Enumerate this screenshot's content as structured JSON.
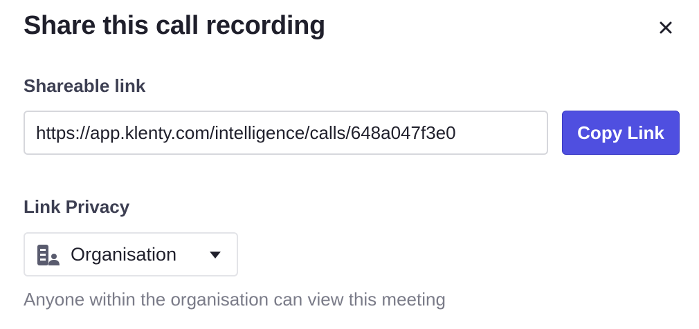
{
  "dialog": {
    "title": "Share this call recording",
    "close_icon": "close-icon"
  },
  "shareable": {
    "label": "Shareable link",
    "url": "https://app.klenty.com/intelligence/calls/648a047f3e0",
    "copy_label": "Copy Link"
  },
  "privacy": {
    "label": "Link Privacy",
    "selected": "Organisation",
    "icon": "organisation-building-icon",
    "helper": "Anyone within the organisation can view this meeting"
  },
  "colors": {
    "accent": "#4f4fe0",
    "title_text": "#1f1f2b",
    "label_text": "#3d3f52",
    "helper_text": "#7a7b88"
  }
}
